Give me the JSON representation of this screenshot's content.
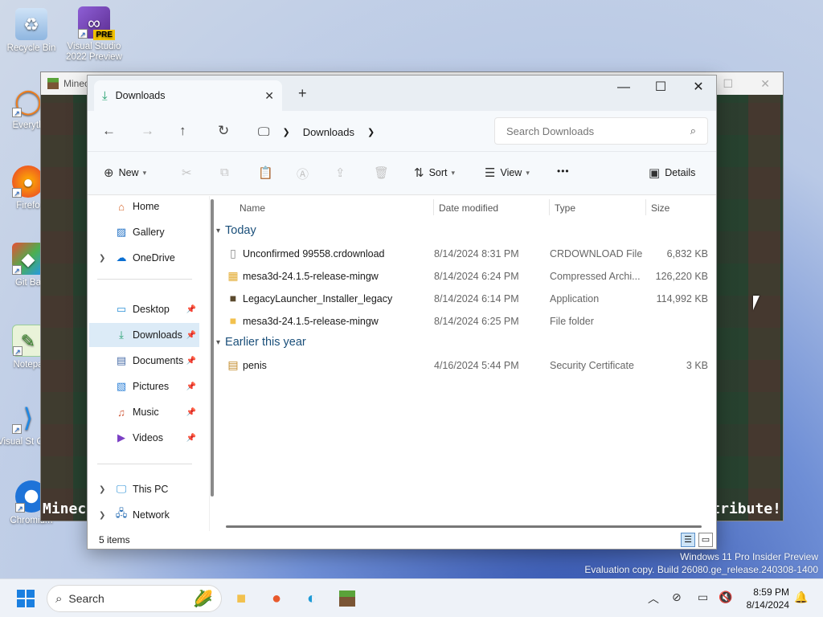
{
  "desktop": {
    "icons": [
      {
        "label": "Recycle Bin",
        "icon": "recycle-bin-icon"
      },
      {
        "label": "Visual Studio 2022 Preview",
        "badge": "PRE",
        "icon": "visual-studio-icon"
      },
      {
        "label": "Everyth",
        "icon": "everything-search-icon"
      },
      {
        "label": "Firefo",
        "icon": "firefox-icon"
      },
      {
        "label": "Git Ba",
        "icon": "git-bash-icon"
      },
      {
        "label": "Notepa",
        "icon": "notepad-icon"
      },
      {
        "label": "Visual St Code",
        "icon": "vscode-icon"
      },
      {
        "label": "Chromium",
        "icon": "chromium-icon"
      }
    ]
  },
  "minecraft": {
    "title": "Minec",
    "bottom_left": "Minec",
    "bottom_right": "stribute!"
  },
  "explorer": {
    "tab": {
      "label": "Downloads"
    },
    "address": {
      "segment": "Downloads"
    },
    "search": {
      "placeholder": "Search Downloads"
    },
    "toolbar": {
      "new_label": "New",
      "sort_label": "Sort",
      "view_label": "View",
      "more_label": "•••",
      "details_label": "Details"
    },
    "sidebar": {
      "items": [
        {
          "label": "Home",
          "icon": "home-icon"
        },
        {
          "label": "Gallery",
          "icon": "gallery-icon"
        },
        {
          "label": "OneDrive",
          "icon": "onedrive-icon"
        },
        {
          "label": "Desktop",
          "icon": "desktop-folder-icon"
        },
        {
          "label": "Downloads",
          "icon": "download-icon"
        },
        {
          "label": "Documents",
          "icon": "documents-icon"
        },
        {
          "label": "Pictures",
          "icon": "pictures-icon"
        },
        {
          "label": "Music",
          "icon": "music-icon"
        },
        {
          "label": "Videos",
          "icon": "videos-icon"
        },
        {
          "label": "This PC",
          "icon": "this-pc-icon"
        },
        {
          "label": "Network",
          "icon": "network-icon"
        }
      ]
    },
    "columns": {
      "name": "Name",
      "date": "Date modified",
      "type": "Type",
      "size": "Size"
    },
    "groups": [
      {
        "label": "Today",
        "files": [
          {
            "name": "Unconfirmed 99558.crdownload",
            "date": "8/14/2024 8:31 PM",
            "type": "CRDOWNLOAD File",
            "size": "6,832 KB",
            "icon": "blank-file-icon"
          },
          {
            "name": "mesa3d-24.1.5-release-mingw",
            "date": "8/14/2024 6:24 PM",
            "type": "Compressed Archi...",
            "size": "126,220 KB",
            "icon": "archive-icon"
          },
          {
            "name": "LegacyLauncher_Installer_legacy",
            "date": "8/14/2024 6:14 PM",
            "type": "Application",
            "size": "114,992 KB",
            "icon": "app-icon"
          },
          {
            "name": "mesa3d-24.1.5-release-mingw",
            "date": "8/14/2024 6:25 PM",
            "type": "File folder",
            "size": "",
            "icon": "folder-icon"
          }
        ]
      },
      {
        "label": "Earlier this year",
        "files": [
          {
            "name": "penis",
            "date": "4/16/2024 5:44 PM",
            "type": "Security Certificate",
            "size": "3 KB",
            "icon": "certificate-icon"
          }
        ]
      }
    ],
    "status": {
      "items_count": "5 items"
    }
  },
  "watermark": {
    "line1": "Windows 11 Pro Insider Preview",
    "line2": "Evaluation copy. Build 26080.ge_release.240308-1400"
  },
  "taskbar": {
    "search_placeholder": "Search",
    "time": "8:59 PM",
    "date": "8/14/2024"
  }
}
